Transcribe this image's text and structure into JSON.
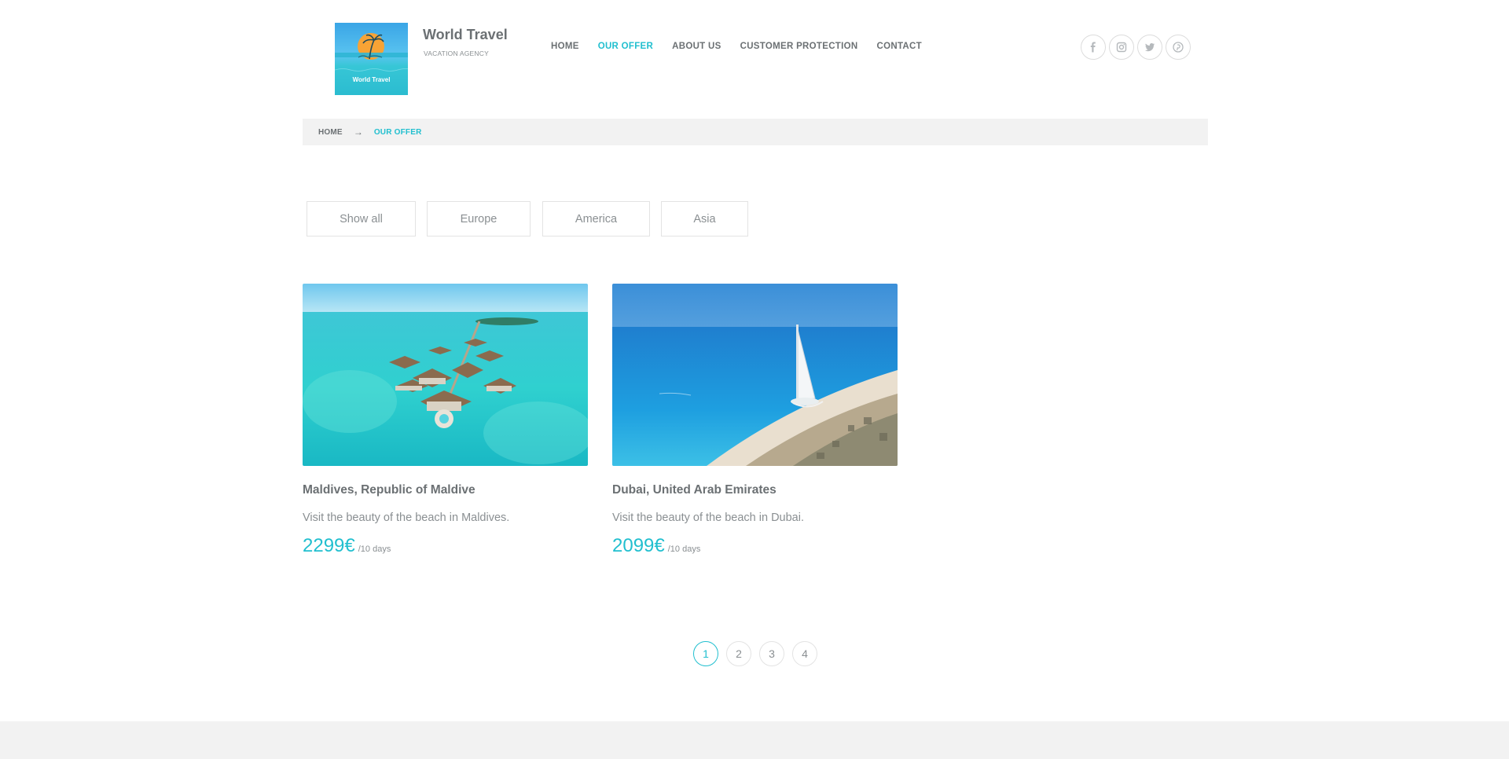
{
  "brand": {
    "logo_caption": "World Travel",
    "title": "World Travel",
    "subtitle": "VACATION AGENCY"
  },
  "nav": {
    "items": [
      {
        "label": "HOME",
        "active": false
      },
      {
        "label": "OUR OFFER",
        "active": true
      },
      {
        "label": "ABOUT US",
        "active": false
      },
      {
        "label": "CUSTOMER PROTECTION",
        "active": false
      },
      {
        "label": "CONTACT",
        "active": false
      }
    ]
  },
  "socials": [
    "facebook-icon",
    "instagram-icon",
    "twitter-icon",
    "pinterest-icon"
  ],
  "breadcrumb": {
    "home": "HOME",
    "arrow": "→",
    "current": "OUR OFFER"
  },
  "filters": [
    "Show all",
    "Europe",
    "America",
    "Asia"
  ],
  "offers": [
    {
      "title": "Maldives, Republic of Maldive",
      "description": "Visit the beauty of the beach in Maldives.",
      "price": "2299€",
      "duration": "/10 days"
    },
    {
      "title": "Dubai, United Arab Emirates",
      "description": "Visit the beauty of the beach in Dubai.",
      "price": "2099€",
      "duration": "/10 days"
    }
  ],
  "pagination": {
    "pages": [
      "1",
      "2",
      "3",
      "4"
    ],
    "current": "1"
  },
  "colors": {
    "accent": "#21bfcf",
    "text": "#6b7073",
    "muted": "#8a8f92",
    "band": "#f2f2f2"
  }
}
